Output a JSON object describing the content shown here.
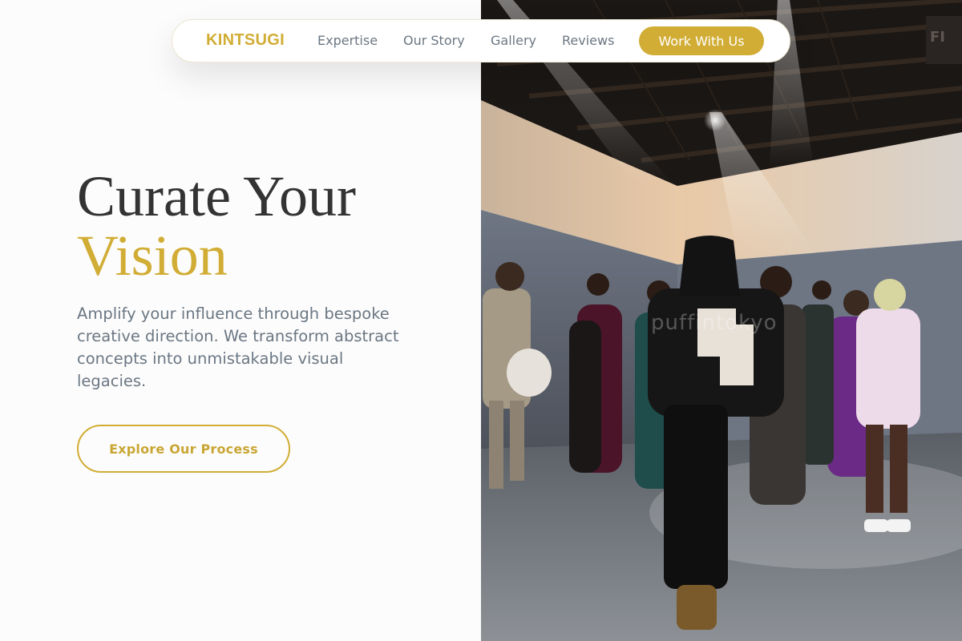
{
  "brand": {
    "name": "KINTSUGI"
  },
  "nav": {
    "links": [
      "Expertise",
      "Our Story",
      "Gallery",
      "Reviews"
    ],
    "cta_label": "Work With Us"
  },
  "hero": {
    "title_line1": "Curate Your",
    "title_line2": "Vision",
    "description": "Amplify your influence through bespoke creative direction. We transform abstract concepts into unmistakable visual legacies.",
    "cta_label": "Explore Our Process"
  },
  "photo": {
    "watermark": "puffintokyo"
  },
  "colors": {
    "accent": "#d1ad35",
    "text_dark": "#333333",
    "text_muted": "#6b7783",
    "background": "#fcfcfc"
  }
}
